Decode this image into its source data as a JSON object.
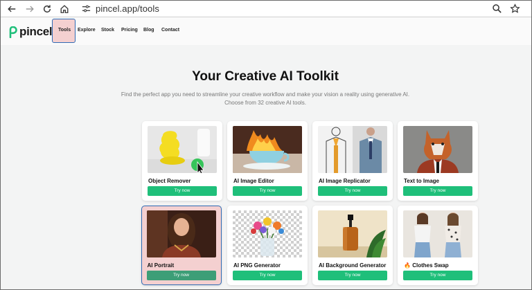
{
  "browser": {
    "url": "pincel.app/tools"
  },
  "site": {
    "logo_text": "pincel",
    "nav": {
      "tools": "Tools",
      "explore": "Explore",
      "stock": "Stock",
      "pricing": "Pricing",
      "blog": "Blog",
      "contact": "Contact"
    }
  },
  "hero": {
    "title": "Your Creative AI Toolkit",
    "subtitle_line1": "Find the perfect app you need to streamline your creative workflow and make your vision a reality using generative AI.",
    "subtitle_line2": "Choose from 32 creative AI tools."
  },
  "tools": [
    {
      "title": "Object Remover",
      "button": "Try now"
    },
    {
      "title": "AI Image Editor",
      "button": "Try now"
    },
    {
      "title": "AI Image Replicator",
      "button": "Try now"
    },
    {
      "title": "Text to Image",
      "button": "Try now"
    },
    {
      "title": "AI Portrait",
      "button": "Try now"
    },
    {
      "title": "AI PNG Generator",
      "button": "Try now"
    },
    {
      "title": "AI Background Generator",
      "button": "Try now"
    },
    {
      "title": "Clothes Swap",
      "button": "Try now",
      "emoji": "🔥"
    }
  ],
  "colors": {
    "accent_green": "#1fbf7a",
    "selection_blue": "#2f6bb5",
    "highlight_pink": "#f4d0d0"
  }
}
